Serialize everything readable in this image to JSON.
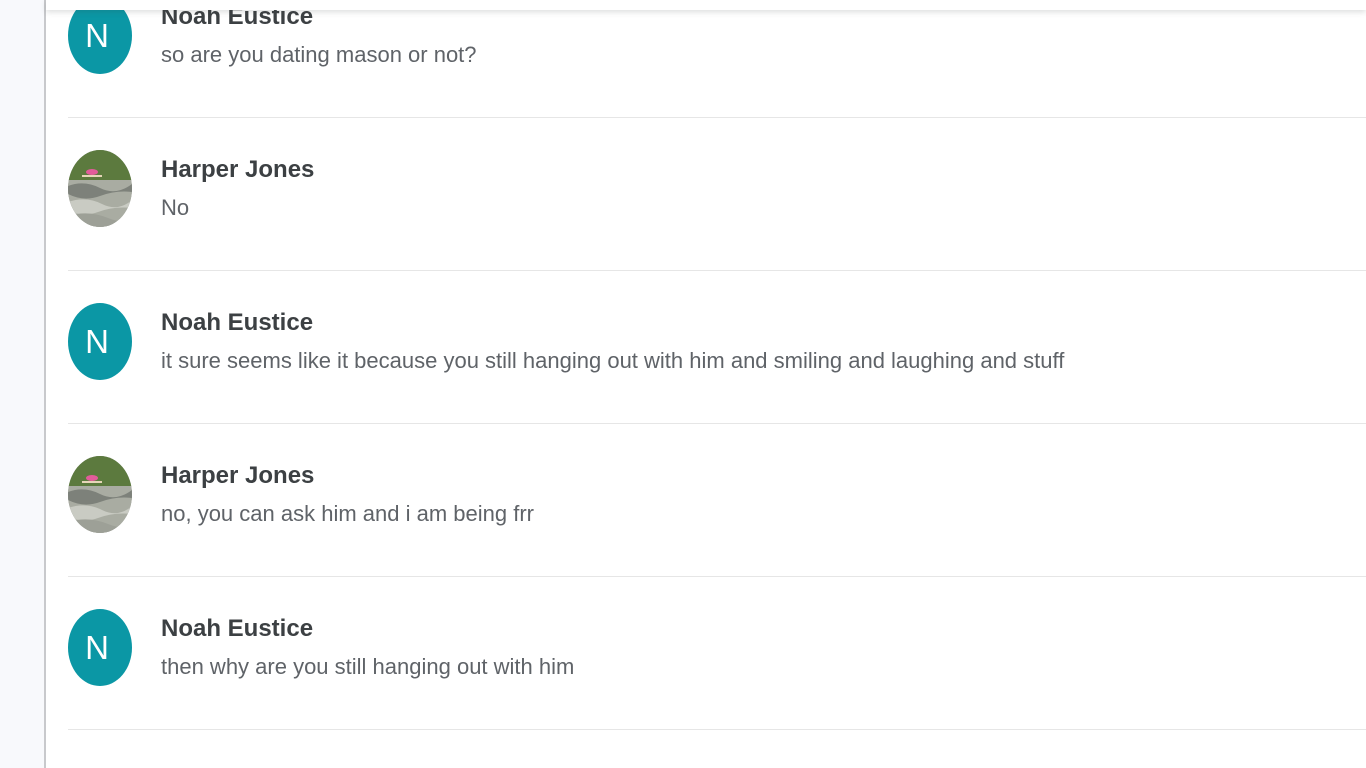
{
  "messages": [
    {
      "sender": "Noah Eustice",
      "avatar_type": "letter",
      "avatar_letter": "N",
      "avatar_color": "#0b97a5",
      "text": "so are you dating mason or not?"
    },
    {
      "sender": "Harper Jones",
      "avatar_type": "photo",
      "text": "No"
    },
    {
      "sender": "Noah Eustice",
      "avatar_type": "letter",
      "avatar_letter": "N",
      "avatar_color": "#0b97a5",
      "text": "it sure seems like it because you still hanging out with him and smiling and laughing and stuff"
    },
    {
      "sender": "Harper Jones",
      "avatar_type": "photo",
      "text": "no, you can ask him and i am being frr"
    },
    {
      "sender": "Noah Eustice",
      "avatar_type": "letter",
      "avatar_letter": "N",
      "avatar_color": "#0b97a5",
      "text": "then why are you still hanging out with him"
    }
  ]
}
